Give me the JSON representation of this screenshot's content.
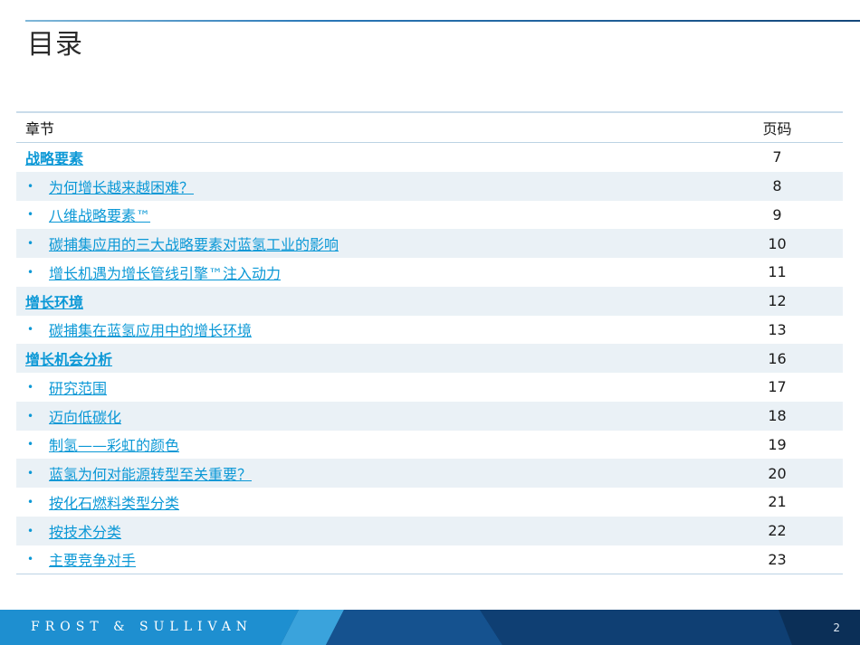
{
  "title": "目录",
  "table": {
    "col_chapter": "章节",
    "col_page": "页码",
    "rows": [
      {
        "kind": "section",
        "label": "战略要素",
        "page": "7"
      },
      {
        "kind": "item",
        "label": "为何增长越来越困难？",
        "page": "8"
      },
      {
        "kind": "item",
        "label": "八维战略要素™",
        "page": "9"
      },
      {
        "kind": "item",
        "label": "碳捕集应用的三大战略要素对蓝氢工业的影响",
        "page": "10"
      },
      {
        "kind": "item",
        "label": "增长机遇为增长管线引擎™注入动力",
        "page": "11"
      },
      {
        "kind": "section",
        "label": "增长环境",
        "page": "12"
      },
      {
        "kind": "item",
        "label": "碳捕集在蓝氢应用中的增长环境",
        "page": "13"
      },
      {
        "kind": "section",
        "label": "增长机会分析",
        "page": "16"
      },
      {
        "kind": "item",
        "label": "研究范围",
        "page": "17"
      },
      {
        "kind": "item",
        "label": "迈向低碳化",
        "page": "18"
      },
      {
        "kind": "item",
        "label": "制氢——彩虹的颜色",
        "page": "19"
      },
      {
        "kind": "item",
        "label": "蓝氢为何对能源转型至关重要？",
        "page": "20"
      },
      {
        "kind": "item",
        "label": "按化石燃料类型分类",
        "page": "21"
      },
      {
        "kind": "item",
        "label": "按技术分类",
        "page": "22"
      },
      {
        "kind": "item",
        "label": "主要竞争对手",
        "page": "23"
      }
    ]
  },
  "footer": {
    "brand": "FROST & SULLIVAN",
    "page_number": "2"
  },
  "colors": {
    "link": "#0b98d6",
    "row_shade": "#eaf1f6",
    "footer_dark": "#0e3d6e",
    "footer_light": "#1e8fd0"
  }
}
